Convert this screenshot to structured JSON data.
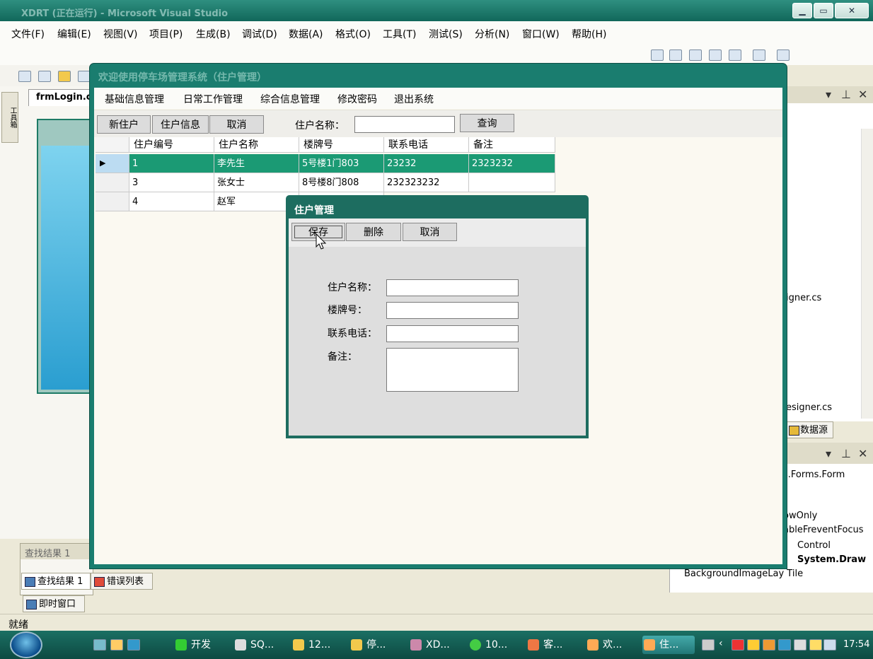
{
  "ide": {
    "title": "XDRT (正在运行) - Microsoft Visual Studio",
    "menu": [
      "文件(F)",
      "编辑(E)",
      "视图(V)",
      "项目(P)",
      "生成(B)",
      "调试(D)",
      "数据(A)",
      "格式(O)",
      "工具(T)",
      "测试(S)",
      "分析(N)",
      "窗口(W)",
      "帮助(H)"
    ],
    "doc_tab": "frmLogin.cs",
    "toolbox_tab": "工具箱",
    "find_panel_title": "查找结果 1",
    "bottom_tabs": [
      "查找结果 1",
      "错误列表",
      "即时窗口"
    ],
    "right_texts": [
      "igner.cs",
      "esigner.cs",
      "数据源"
    ],
    "props_type": "s.Forms.Form",
    "props": [
      "owOnly",
      "ableFreventFocus",
      "Control",
      "System.Draw",
      "BackgroundImageLay Tile"
    ],
    "status": "就绪"
  },
  "app": {
    "title": "欢迎使用停车场管理系统（住户管理）",
    "menu": [
      "基础信息管理",
      "日常工作管理",
      "综合信息管理",
      "修改密码",
      "退出系统"
    ],
    "toolbar": {
      "new_label": "新住户",
      "info_label": "住户信息",
      "cancel_label": "取消",
      "search_label": "住户名称：",
      "search_value": "",
      "query_label": "查询"
    },
    "grid": {
      "columns": [
        "住户编号",
        "住户名称",
        "楼牌号",
        "联系电话",
        "备注"
      ],
      "rows": [
        [
          "1",
          "李先生",
          "5号楼1门803",
          "23232",
          "2323232"
        ],
        [
          "3",
          "张女士",
          "8号楼8门808",
          "232323232",
          ""
        ],
        [
          "4",
          "赵军",
          "",
          "",
          ""
        ]
      ],
      "selected_row": 0
    }
  },
  "dialog": {
    "title": "住户管理",
    "save_label": "保存",
    "delete_label": "删除",
    "cancel_label": "取消",
    "fields": [
      {
        "label": "住户名称：",
        "value": ""
      },
      {
        "label": "楼牌号：",
        "value": ""
      },
      {
        "label": "联系电话：",
        "value": ""
      },
      {
        "label": "备注：",
        "value": ""
      }
    ]
  },
  "taskbar": {
    "items": [
      "开发",
      "SQ...",
      "12...",
      "停...",
      "XD...",
      "10...",
      "客...",
      "欢...",
      "住..."
    ],
    "time": "17:54"
  },
  "colors": {
    "accent": "#1b9a74",
    "window_frame": "#1a7d6f"
  }
}
